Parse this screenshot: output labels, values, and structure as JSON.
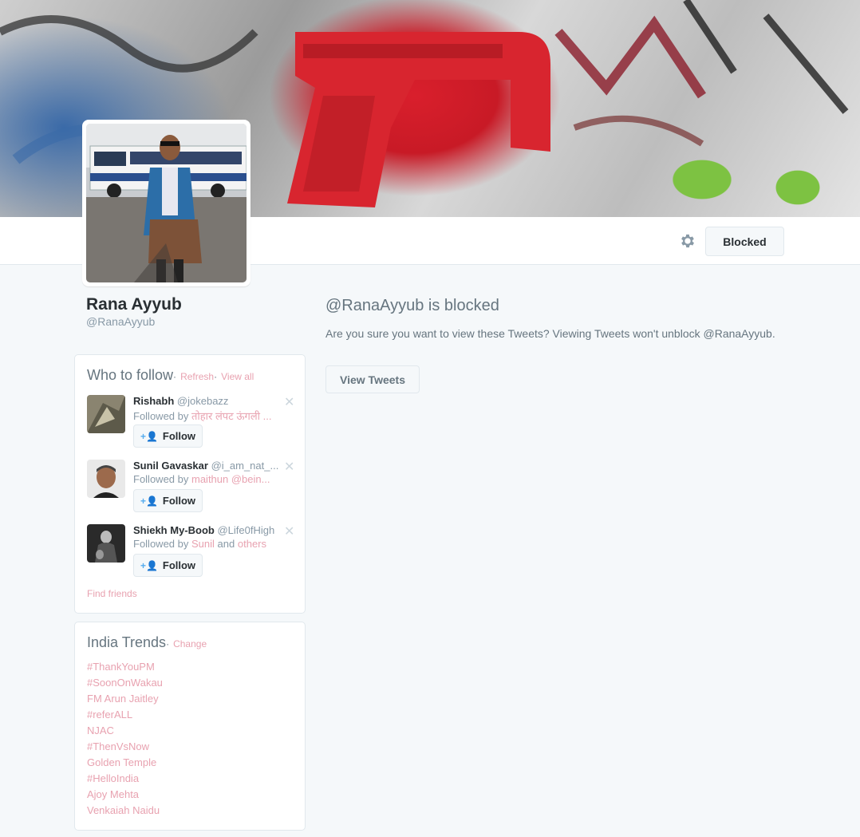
{
  "profile": {
    "name": "Rana Ayyub",
    "handle": "@RanaAyyub",
    "action_button": "Blocked"
  },
  "blocked_notice": {
    "title": "@RanaAyyub is blocked",
    "description": "Are you sure you want to view these Tweets? Viewing Tweets won't unblock @RanaAyyub.",
    "button": "View Tweets"
  },
  "who_to_follow": {
    "title": "Who to follow",
    "separator": "·",
    "refresh": "Refresh",
    "view_all": "View all",
    "follow_label": "Follow",
    "followed_by_prefix": "Followed by",
    "users": [
      {
        "name": "Rishabh",
        "screen_name": "@jokebazz",
        "followed_by": "तोहार लंपट ऊंगली ...",
        "and_text": "",
        "others": ""
      },
      {
        "name": "Sunil Gavaskar",
        "screen_name": "@i_am_nat_...",
        "followed_by": "maithun @bein...",
        "and_text": "",
        "others": ""
      },
      {
        "name": "Shiekh My-Boob",
        "screen_name": "@Life0fHigh",
        "followed_by": "Sunil",
        "and_text": "and",
        "others": "others"
      }
    ],
    "find_friends": "Find friends"
  },
  "trends": {
    "title": "India Trends",
    "separator": "·",
    "change": "Change",
    "items": [
      "#ThankYouPM",
      "#SoonOnWakau",
      "FM Arun Jaitley",
      "#referALL",
      "NJAC",
      "#ThenVsNow",
      "Golden Temple",
      "#HelloIndia",
      "Ajoy Mehta",
      "Venkaiah Naidu"
    ]
  },
  "icons": {
    "settings": "gear-icon",
    "dismiss": "close-icon",
    "follow": "add-person-icon"
  },
  "colors": {
    "link": "#e8a2b0",
    "follow_icon": "#55acee",
    "muted_text": "#66757f"
  }
}
